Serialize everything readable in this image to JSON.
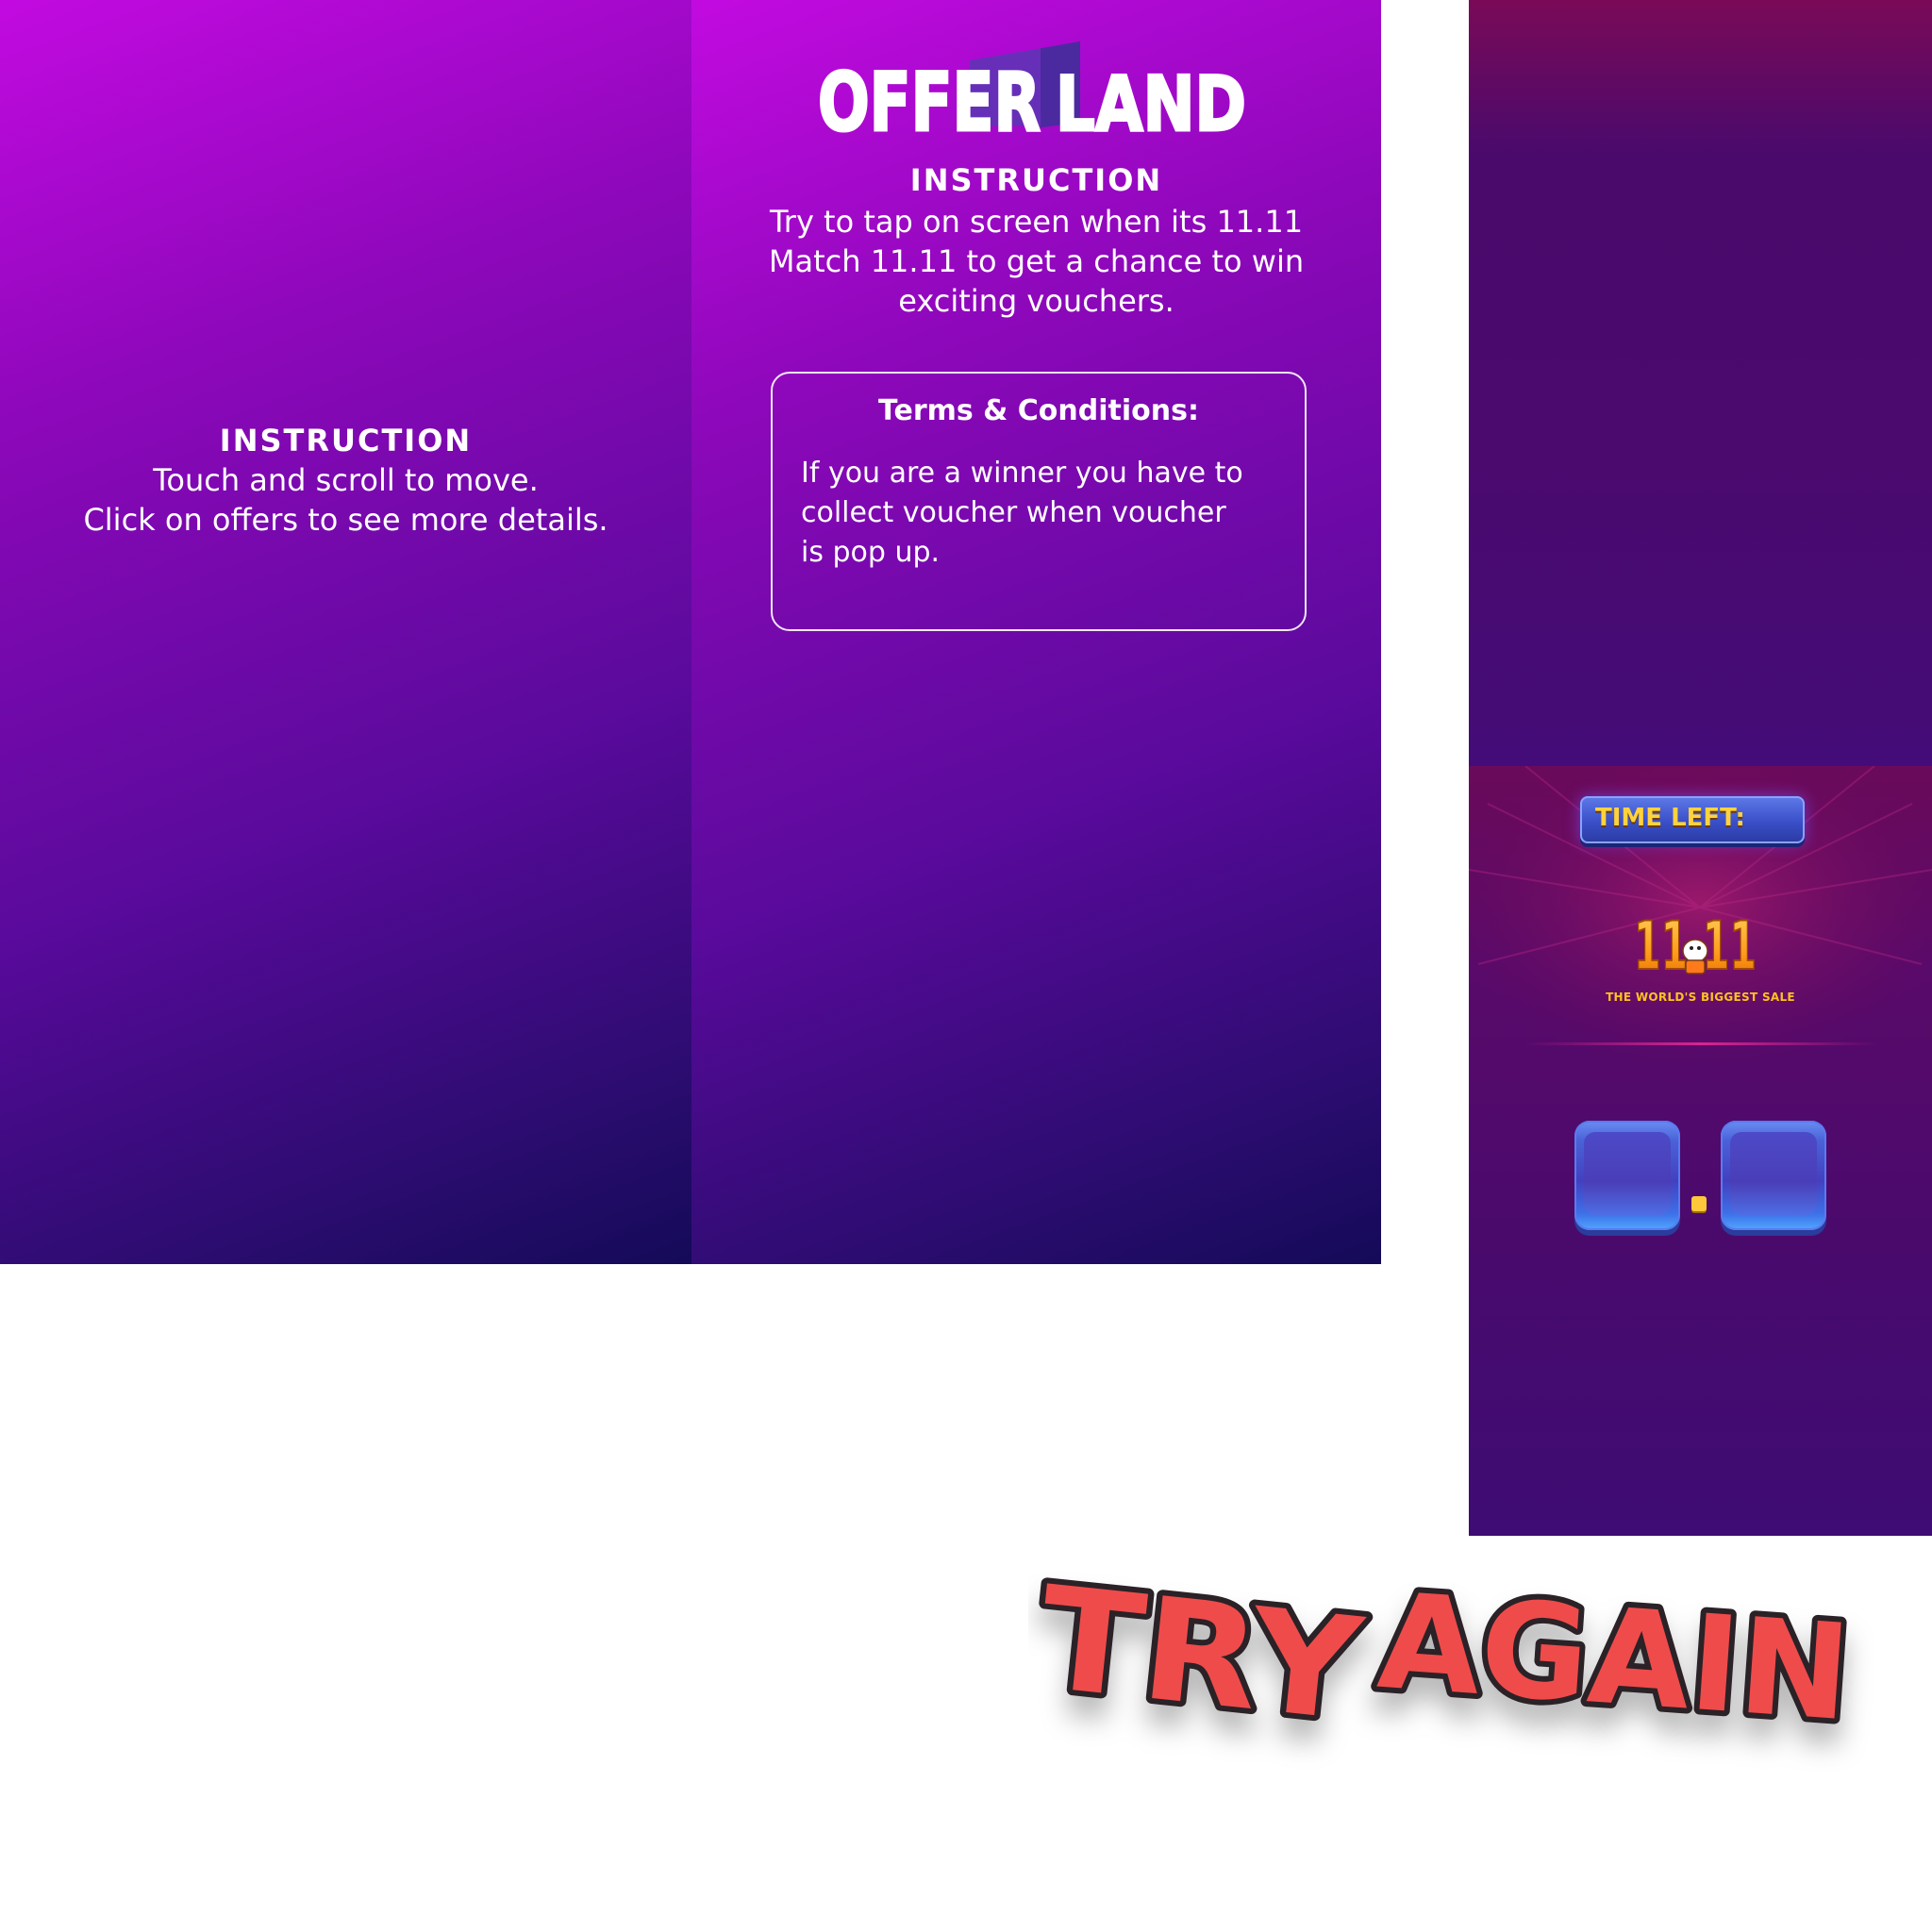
{
  "left_panel": {
    "instruction_title": "INSTRUCTION",
    "instruction_lines": [
      "Touch and scroll to move.",
      "Click on offers to see more details."
    ]
  },
  "middle_panel": {
    "logo_text": [
      "OFFER",
      "LAND"
    ],
    "instruction_title": "INSTRUCTION",
    "instruction_lines": [
      "Try to tap on screen when its 11.11",
      "Match 11.11 to get a chance to win",
      "exciting vouchers."
    ],
    "terms": {
      "title": "Terms & Conditions:",
      "lines": [
        "If you are a winner you have to",
        "collect voucher when voucher",
        "is pop up."
      ]
    }
  },
  "right_panel": {
    "time_left_label": "TIME LEFT:",
    "sale_logo_text": "11.11",
    "sale_caption": "THE WORLD'S BIGGEST SALE",
    "digit_separator": "."
  },
  "try_again_text": [
    "TRY",
    "AGAIN"
  ],
  "colors": {
    "panel_top": "#c20ae0",
    "panel_bottom": "#140a58",
    "badge_text": "#ffd23c",
    "try_again_fill": "#ef4b4b",
    "try_again_outline": "#2a2228"
  }
}
